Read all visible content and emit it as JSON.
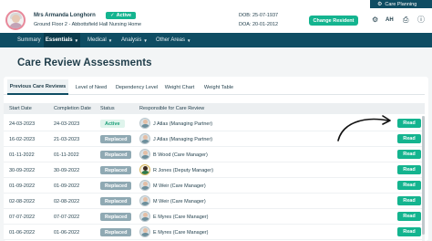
{
  "topbar": {
    "care_planning": "Care Planning"
  },
  "resident": {
    "name": "Mrs Armanda Longhorn",
    "status": "Active",
    "location": "Ground Floor 2 - Abbottsfield Hall Nursing Home",
    "dob": "DOB: 25-07-1937",
    "doa": "DOA: 20-01-2012"
  },
  "header": {
    "change_resident": "Change Resident",
    "user_initials": "AH"
  },
  "nav": {
    "items": [
      {
        "label": "Summary"
      },
      {
        "label": "Essentials"
      },
      {
        "label": "Medical"
      },
      {
        "label": "Analysis"
      },
      {
        "label": "Other Areas"
      }
    ]
  },
  "page": {
    "title": "Care Review Assessments"
  },
  "tabs": [
    {
      "label": "Previous Care Reviews"
    },
    {
      "label": "Level of Need"
    },
    {
      "label": "Dependency Level"
    },
    {
      "label": "Weight Chart"
    },
    {
      "label": "Weight Table"
    }
  ],
  "table": {
    "headers": [
      "Start Date",
      "Completion Date",
      "Status",
      "Responsible for Care Review"
    ],
    "read_label": "Read",
    "rows": [
      {
        "start": "24-03-2023",
        "completion": "24-03-2023",
        "status": "Active",
        "responsible": "J Atlas (Managing Partner)"
      },
      {
        "start": "16-02-2023",
        "completion": "21-03-2023",
        "status": "Replaced",
        "responsible": "J Atlas (Managing Partner)"
      },
      {
        "start": "01-11-2022",
        "completion": "01-11-2022",
        "status": "Replaced",
        "responsible": "B Wood (Care Manager)"
      },
      {
        "start": "30-09-2022",
        "completion": "30-09-2022",
        "status": "Replaced",
        "responsible": "R Jones (Deputy Manager)"
      },
      {
        "start": "01-09-2022",
        "completion": "01-09-2022",
        "status": "Replaced",
        "responsible": "M Weir (Care Manager)"
      },
      {
        "start": "02-08-2022",
        "completion": "02-08-2022",
        "status": "Replaced",
        "responsible": "M Weir (Care Manager)"
      },
      {
        "start": "07-07-2022",
        "completion": "07-07-2022",
        "status": "Replaced",
        "responsible": "E Myres (Care Manager)"
      },
      {
        "start": "01-06-2022",
        "completion": "01-06-2022",
        "status": "Replaced",
        "responsible": "E Myres (Care Manager)"
      }
    ]
  },
  "icons": {
    "care_planning": "gear-icon",
    "active_badge": "check-icon",
    "header": [
      "gear-icon",
      "user-initials",
      "print-icon",
      "info-icon"
    ],
    "annotation": "curved-arrow-icon"
  }
}
